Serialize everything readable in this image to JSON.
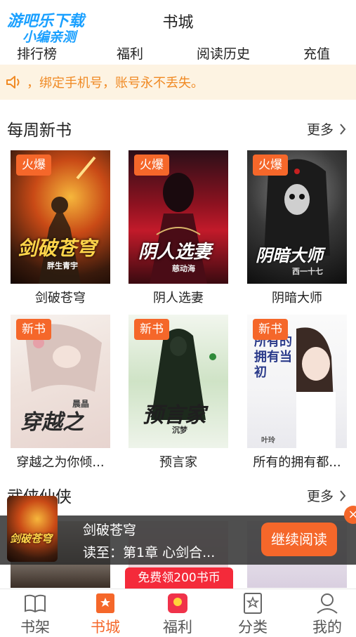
{
  "watermark": {
    "line1": "游吧乐下载",
    "line2": "小编亲测"
  },
  "header": {
    "title": "书城"
  },
  "tabs": [
    "排行榜",
    "福利",
    "阅读历史",
    "充值"
  ],
  "notice": {
    "text": "，绑定手机号，账号永不丢失。"
  },
  "weekly": {
    "title": "每周新书",
    "more": "更多",
    "books": [
      {
        "title": "剑破苍穹",
        "tag": "火爆",
        "cover_text": "剑破苍穹",
        "cover_author": "胖生青宇"
      },
      {
        "title": "阴人选妻",
        "tag": "火爆",
        "cover_text": "阴人选妻",
        "cover_author": "慈动海"
      },
      {
        "title": "阴暗大师",
        "tag": "火爆",
        "cover_text": "阴暗大师",
        "cover_author": "西一十七"
      },
      {
        "title": "穿越之为你倾...",
        "tag": "新书",
        "cover_text": "穿越之",
        "cover_author": "晨晶"
      },
      {
        "title": "预言家",
        "tag": "新书",
        "cover_text": "预言家",
        "cover_author": "沉梦"
      },
      {
        "title": "所有的拥有都...",
        "tag": "新书",
        "cover_text": "所有的拥有当初",
        "cover_author": "叶玲"
      }
    ]
  },
  "wuxia": {
    "title": "武侠仙侠",
    "more": "更多"
  },
  "reading_bar": {
    "book_title": "剑破苍穹",
    "progress": "读至：第1章 心剑合...",
    "continue_label": "继续阅读",
    "close_label": "×"
  },
  "promo": {
    "text": "免费领200书币"
  },
  "bottom_nav": {
    "items": [
      "书架",
      "书城",
      "福利",
      "分类",
      "我的"
    ],
    "active": "书城"
  },
  "colors": {
    "accent": "#f5672a",
    "notice_bg": "#fdf3e2",
    "notice_text": "#f08a24",
    "promo": "#f42a3a"
  }
}
